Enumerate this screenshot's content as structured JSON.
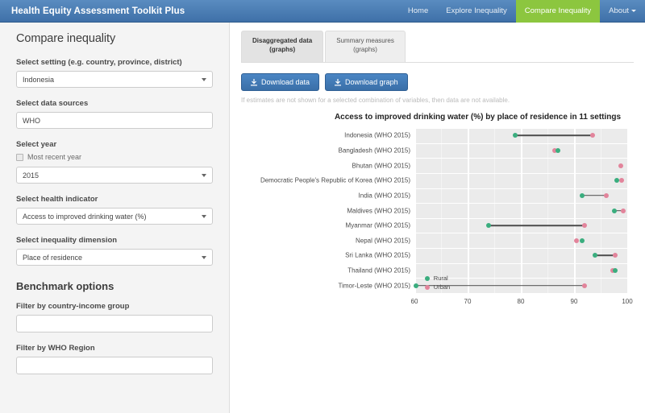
{
  "header": {
    "brand": "Health Equity Assessment Toolkit Plus",
    "nav": [
      {
        "label": "Home",
        "active": false
      },
      {
        "label": "Explore Inequality",
        "active": false
      },
      {
        "label": "Compare Inequality",
        "active": true
      },
      {
        "label": "About",
        "active": false,
        "caret": true
      }
    ],
    "accent_active": "#8cc63f",
    "bar_color": "#4a7cb4"
  },
  "sidebar": {
    "title": "Compare inequality",
    "fields": [
      {
        "label": "Select setting (e.g. country, province, district)",
        "value": "Indonesia",
        "type": "select"
      },
      {
        "label": "Select data sources",
        "value": "WHO",
        "type": "text"
      },
      {
        "label": "Select year",
        "value": "2015",
        "type": "select",
        "checkbox": "Most recent year"
      },
      {
        "label": "Select health indicator",
        "value": "Access to improved drinking water (%)",
        "type": "select"
      },
      {
        "label": "Select inequality dimension",
        "value": "Place of residence",
        "type": "select"
      }
    ],
    "benchmark": {
      "title": "Benchmark options",
      "fields": [
        {
          "label": "Filter by country-income group",
          "value": ""
        },
        {
          "label": "Filter by WHO Region",
          "value": ""
        }
      ]
    }
  },
  "main": {
    "tabs": [
      {
        "line1": "Disaggregated data",
        "line2": "(graphs)",
        "active": true
      },
      {
        "line1": "Summary measures",
        "line2": "(graphs)",
        "active": false
      }
    ],
    "buttons": [
      {
        "label": "Download data",
        "icon": "download-icon"
      },
      {
        "label": "Download graph",
        "icon": "download-icon"
      }
    ],
    "note": "If estimates are not shown for a selected combination of variables, then data are not available."
  },
  "chart_data": {
    "type": "scatter",
    "title": "Access to improved drinking water (%) by place of residence in 11 settings",
    "xlabel": "",
    "ylabel": "",
    "xlim": [
      60,
      100
    ],
    "xticks": [
      60,
      70,
      80,
      90,
      100
    ],
    "grid": true,
    "legend_position": "bottom",
    "series": [
      {
        "name": "Rural",
        "color": "#3aad7e"
      },
      {
        "name": "Urban",
        "color": "#e2849b"
      }
    ],
    "categories": [
      "Indonesia (WHO 2015)",
      "Bangladesh (WHO 2015)",
      "Bhutan (WHO 2015)",
      "Democratic People's Republic of Korea (WHO 2015)",
      "India (WHO 2015)",
      "Maldives (WHO 2015)",
      "Myanmar (WHO 2015)",
      "Nepal (WHO 2015)",
      "Sri Lanka (WHO 2015)",
      "Thailand (WHO 2015)",
      "Timor-Leste (WHO 2015)"
    ],
    "points": [
      {
        "setting": "Indonesia (WHO 2015)",
        "rural": 79.0,
        "urban": 93.5
      },
      {
        "setting": "Bangladesh (WHO 2015)",
        "rural": 87.0,
        "urban": 86.3
      },
      {
        "setting": "Bhutan (WHO 2015)",
        "rural": null,
        "urban": 98.8
      },
      {
        "setting": "Democratic People's Republic of Korea (WHO 2015)",
        "rural": 98.1,
        "urban": 99.0
      },
      {
        "setting": "India (WHO 2015)",
        "rural": 91.5,
        "urban": 96.0
      },
      {
        "setting": "Maldives (WHO 2015)",
        "rural": 97.6,
        "urban": 99.2
      },
      {
        "setting": "Myanmar (WHO 2015)",
        "rural": 74.0,
        "urban": 92.0
      },
      {
        "setting": "Nepal (WHO 2015)",
        "rural": 91.5,
        "urban": 90.5
      },
      {
        "setting": "Sri Lanka (WHO 2015)",
        "rural": 94.0,
        "urban": 97.8
      },
      {
        "setting": "Thailand (WHO 2015)",
        "rural": 97.7,
        "urban": 97.3
      },
      {
        "setting": "Timor-Leste (WHO 2015)",
        "rural": 60.3,
        "urban": 92.0
      }
    ]
  }
}
